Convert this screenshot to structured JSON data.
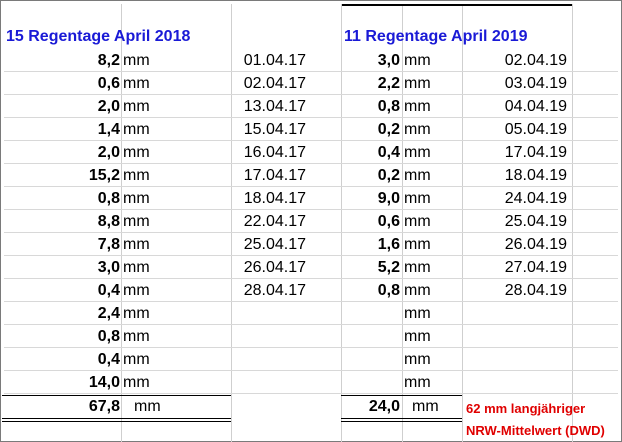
{
  "title_2018": "15 Regentage April 2018",
  "title_2019": "11 Regentage April 2019",
  "unit": "mm",
  "rows_2018": [
    {
      "value": "8,2",
      "date": "01.04.17"
    },
    {
      "value": "0,6",
      "date": "02.04.17"
    },
    {
      "value": "2,0",
      "date": "13.04.17"
    },
    {
      "value": "1,4",
      "date": "15.04.17"
    },
    {
      "value": "2,0",
      "date": "16.04.17"
    },
    {
      "value": "15,2",
      "date": "17.04.17"
    },
    {
      "value": "0,8",
      "date": "18.04.17"
    },
    {
      "value": "8,8",
      "date": "22.04.17"
    },
    {
      "value": "7,8",
      "date": "25.04.17"
    },
    {
      "value": "3,0",
      "date": "26.04.17"
    },
    {
      "value": "0,4",
      "date": "28.04.17"
    },
    {
      "value": "2,4",
      "date": ""
    },
    {
      "value": "0,8",
      "date": ""
    },
    {
      "value": "0,4",
      "date": ""
    },
    {
      "value": "14,0",
      "date": ""
    }
  ],
  "rows_2019": [
    {
      "value": "3,0",
      "date": "02.04.19"
    },
    {
      "value": "2,2",
      "date": "03.04.19"
    },
    {
      "value": "0,8",
      "date": "04.04.19"
    },
    {
      "value": "0,2",
      "date": "05.04.19"
    },
    {
      "value": "0,4",
      "date": "17.04.19"
    },
    {
      "value": "0,2",
      "date": "18.04.19"
    },
    {
      "value": "9,0",
      "date": "24.04.19"
    },
    {
      "value": "0,6",
      "date": "25.04.19"
    },
    {
      "value": "1,6",
      "date": "26.04.19"
    },
    {
      "value": "5,2",
      "date": "27.04.19"
    },
    {
      "value": "0,8",
      "date": "28.04.19"
    },
    {
      "value": "",
      "date": ""
    },
    {
      "value": "",
      "date": ""
    },
    {
      "value": "",
      "date": ""
    },
    {
      "value": "",
      "date": ""
    }
  ],
  "total_2018": "67,8",
  "total_2019": "24,0",
  "note_line1": "62 mm langjähriger",
  "note_line2": "NRW-Mittelwert (DWD)"
}
